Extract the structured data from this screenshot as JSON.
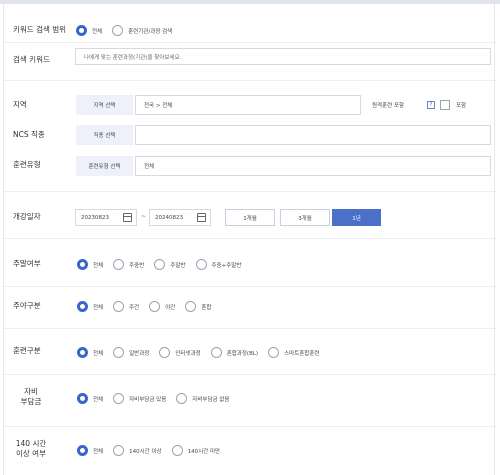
{
  "search_scope": {
    "label": "키워드 검색 범위",
    "options": [
      {
        "label": "전체",
        "selected": true
      },
      {
        "label": "훈련기관/과정 검색",
        "selected": false
      }
    ]
  },
  "keyword": {
    "label": "검색 키워드",
    "placeholder": "나에게 맞는 훈련과정(기관)을 찾아보세요."
  },
  "region": {
    "label": "지역",
    "button": "지역 선택",
    "value": "전국 > 전체",
    "mixed_label": "원격훈련 포함",
    "help": "?",
    "include_label": "포함"
  },
  "ncs": {
    "label": "NCS 직종",
    "button": "직종 선택",
    "value": ""
  },
  "training_type": {
    "label": "훈련유형",
    "button": "훈련유형 선택",
    "value": "전체"
  },
  "start_date": {
    "label": "개강일자",
    "from": "20230823",
    "tilde": "~",
    "to": "20240823",
    "periods": [
      {
        "label": "1개월",
        "selected": false
      },
      {
        "label": "3개월",
        "selected": false
      },
      {
        "label": "1년",
        "selected": true
      }
    ]
  },
  "weekend": {
    "label": "주말여부",
    "options": [
      {
        "label": "전체",
        "selected": true
      },
      {
        "label": "주중반",
        "selected": false
      },
      {
        "label": "주말반",
        "selected": false
      },
      {
        "label": "주중+주말반",
        "selected": false
      }
    ]
  },
  "daynight": {
    "label": "주야구분",
    "options": [
      {
        "label": "전체",
        "selected": true
      },
      {
        "label": "주간",
        "selected": false
      },
      {
        "label": "야간",
        "selected": false
      },
      {
        "label": "혼합",
        "selected": false
      }
    ]
  },
  "training_kind": {
    "label": "훈련구분",
    "options": [
      {
        "label": "전체",
        "selected": true
      },
      {
        "label": "일반과정",
        "selected": false
      },
      {
        "label": "인터넷과정",
        "selected": false
      },
      {
        "label": "혼합과정(BL)",
        "selected": false
      },
      {
        "label": "스마트혼합훈련",
        "selected": false
      }
    ]
  },
  "self_pay": {
    "label_line1": "자비",
    "label_line2": "부담금",
    "options": [
      {
        "label": "전체",
        "selected": true
      },
      {
        "label": "자비부담금 있음",
        "selected": false
      },
      {
        "label": "자비부담금 없음",
        "selected": false
      }
    ]
  },
  "hours140": {
    "label_line1": "140 시간",
    "label_line2": "이상 여부",
    "options": [
      {
        "label": "전체",
        "selected": true
      },
      {
        "label": "140시간 이상",
        "selected": false
      },
      {
        "label": "140시간 미만",
        "selected": false
      }
    ]
  },
  "colors": {
    "accent": "#3866c8",
    "button_bg": "#eef1f9",
    "period_active": "#4a70c8"
  }
}
